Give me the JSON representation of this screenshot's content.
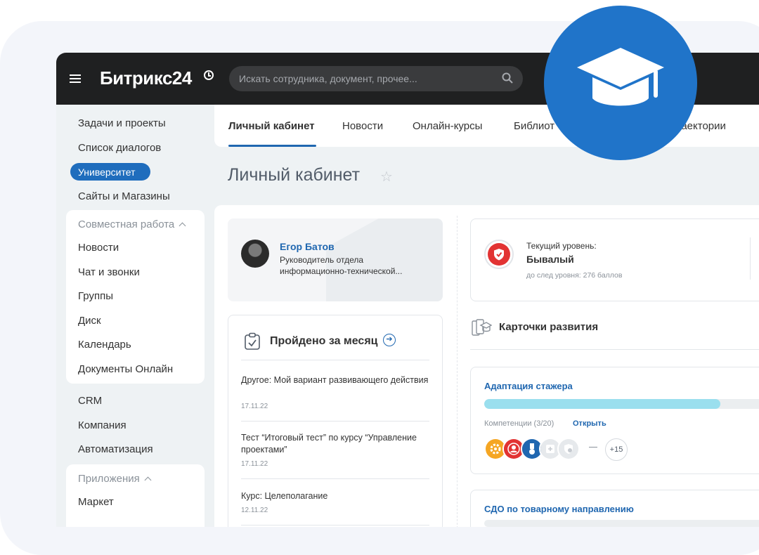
{
  "topbar": {
    "logo": "Битрикс24",
    "search_placeholder": "Искать сотрудника, документ, прочее..."
  },
  "sidebar": {
    "items_top": [
      "Задачи и проекты",
      "Список диалогов",
      "Университет",
      "Сайты и Магазины"
    ],
    "group1": {
      "title": "Совместная работа",
      "items": [
        "Новости",
        "Чат и звонки",
        "Группы",
        "Диск",
        "Календарь",
        "Документы Онлайн"
      ]
    },
    "items_mid": [
      "CRM",
      "Компания",
      "Автоматизация"
    ],
    "group2": {
      "title": "Приложения",
      "items": [
        "Маркет"
      ]
    }
  },
  "tabs": [
    "Личный кабинет",
    "Новости",
    "Онлайн-курсы",
    "Библиот",
    "раектории"
  ],
  "page": {
    "title": "Личный кабинет"
  },
  "profile": {
    "name": "Егор Батов",
    "role_line1": "Руководитель отдела",
    "role_line2": "информационно-технической..."
  },
  "month": {
    "title": "Пройдено за месяц",
    "items": [
      {
        "text": "Другое: Мой вариант развивающего действия",
        "date": "17.11.22"
      },
      {
        "text": "Тест “Итоговый тест” по курсу “Управление проектами”",
        "date": "17.11.22"
      },
      {
        "text": "Курс: Целеполагание",
        "date": "12.11.22"
      }
    ]
  },
  "level": {
    "label": "Текущий уровень:",
    "value": "Бывалый",
    "next": "до след уровня: 276 баллов"
  },
  "cards": {
    "title": "Карточки развития"
  },
  "adapt": {
    "title": "Адаптация стажера",
    "progress": 0.8,
    "competencies": "Компетенции (3/20)",
    "open": "Открыть",
    "more": "+15",
    "badge_colors": [
      "#f5a623",
      "#e23333",
      "#2067b0",
      "#d5d9de",
      "#d5d9de"
    ]
  },
  "sdo": {
    "title": "СДО по товарному направлению"
  },
  "colors": {
    "accent": "#2067b0",
    "topbar": "#1f2021",
    "cap_circle": "#2074c9"
  }
}
